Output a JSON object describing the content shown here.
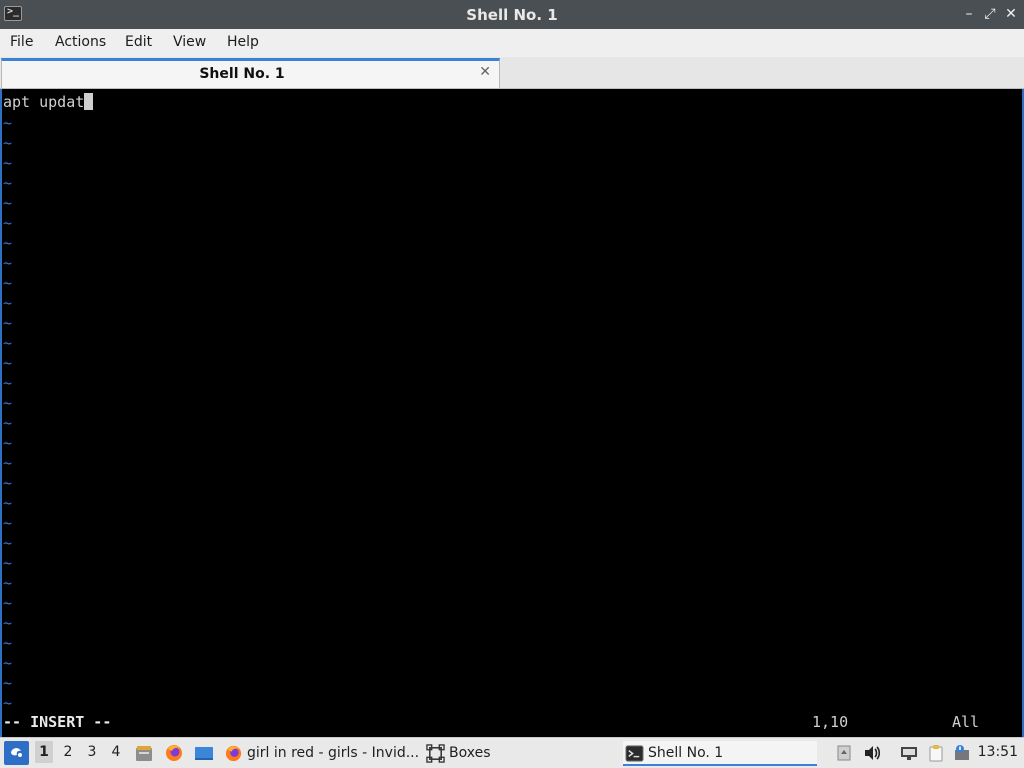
{
  "window": {
    "title": "Shell No. 1",
    "app_icon_glyph": ">_",
    "buttons": {
      "minimize": "–",
      "maximize": "⤢",
      "close": "✕"
    }
  },
  "menubar": [
    "File",
    "Actions",
    "Edit",
    "View",
    "Help"
  ],
  "tabs": [
    {
      "label": "Shell No. 1",
      "close_glyph": "✕"
    }
  ],
  "terminal": {
    "line1": "apt updat",
    "tilde": "~",
    "mode": "-- INSERT --",
    "position": "1,10",
    "scroll": "All"
  },
  "taskbar": {
    "workspaces": [
      "1",
      "2",
      "3",
      "4"
    ],
    "active_workspace": "1",
    "tasks": [
      {
        "label": "girl in red - girls - Invid...",
        "icon": "firefox-icon"
      },
      {
        "label": "Boxes",
        "icon": "boxes-icon"
      },
      {
        "label": "Shell No. 1",
        "icon": "terminal-icon"
      }
    ],
    "clock": "13:51"
  },
  "colors": {
    "titlebar": "#4a4f54",
    "accent": "#3b82d6",
    "tilde": "#3a6fd1",
    "terminal_bg": "#000000"
  }
}
